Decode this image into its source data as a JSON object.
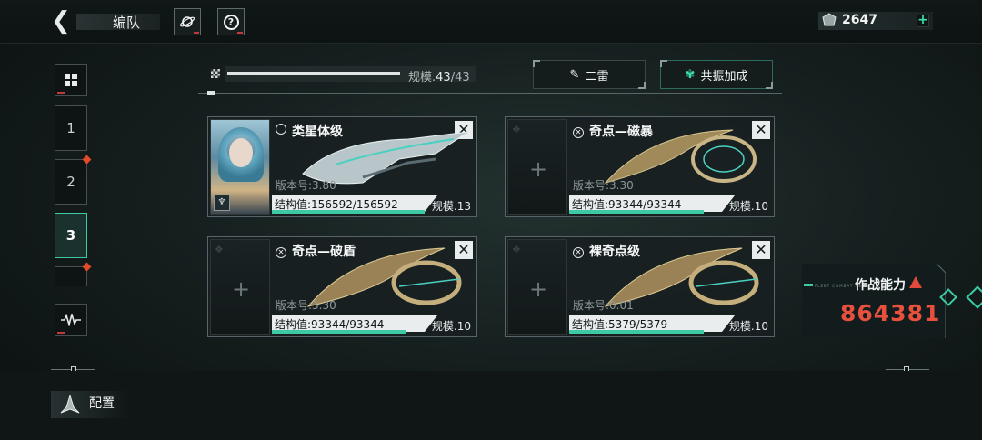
{
  "header": {
    "title": "编队",
    "currency": "2647",
    "currency_plus": "+",
    "help_label": "?"
  },
  "sidebar": {
    "items": [
      {
        "label": "1"
      },
      {
        "label": "2"
      },
      {
        "label": "3"
      }
    ]
  },
  "fleet": {
    "scale_prefix": "规模.",
    "scale_current": "43",
    "scale_total": "/43",
    "scale_progress": 1.0,
    "button_secondary": "二雷",
    "button_resonance": "共振加成"
  },
  "cards": [
    {
      "name": "类星体级",
      "version": "版本号:3.80",
      "hp": "结构值:156592/156592",
      "hp_fraction": 1.0,
      "scale": "规模.13",
      "has_captain": true
    },
    {
      "name": "奇点—磁暴",
      "version": "版本号:3.30",
      "hp": "结构值:93344/93344",
      "hp_fraction": 1.0,
      "scale": "规模.10",
      "has_captain": false
    },
    {
      "name": "奇点—破盾",
      "version": "版本号:3.30",
      "hp": "结构值:93344/93344",
      "hp_fraction": 1.0,
      "scale": "规模.10",
      "has_captain": false
    },
    {
      "name": "裸奇点级",
      "version": "版本号:0.01",
      "hp": "结构值:5379/5379",
      "hp_fraction": 1.0,
      "scale": "规模.10",
      "has_captain": false
    }
  ],
  "combat": {
    "label": "作战能力",
    "sub_label": "FLEET COMBAT ABILITY",
    "value": "864381"
  },
  "footer": {
    "config_label": "配置"
  },
  "colors": {
    "accent": "#3cc9a4",
    "warning": "#e04a3a",
    "power": "#e8503e"
  }
}
